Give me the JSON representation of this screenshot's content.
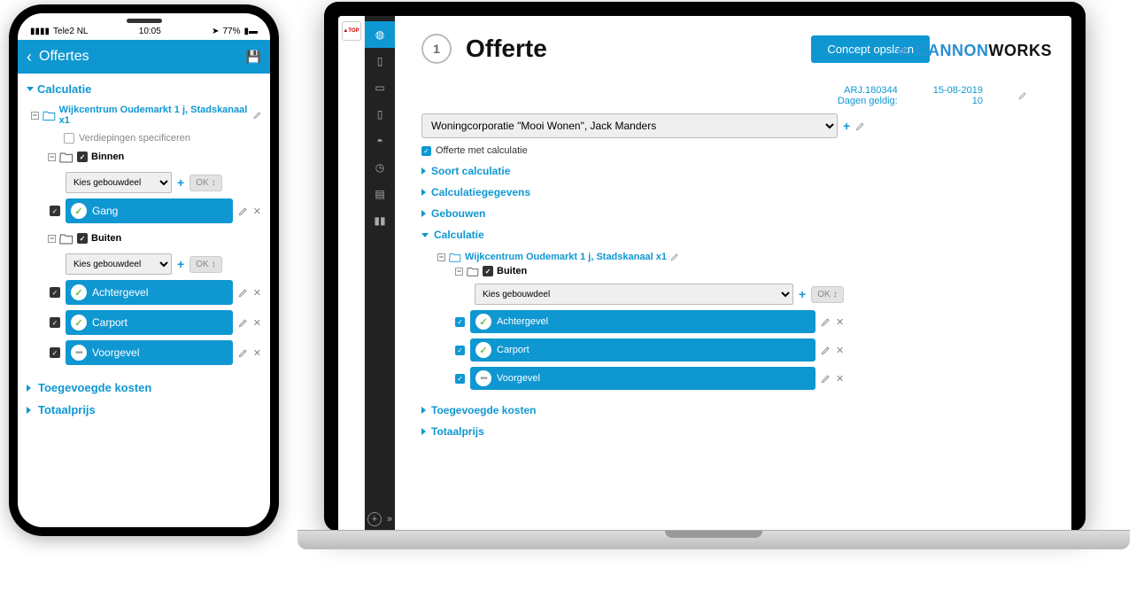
{
  "phone": {
    "carrier": "Tele2 NL",
    "time": "10:05",
    "battery": "77%",
    "header": {
      "title": "Offertes"
    },
    "calc_label": "Calculatie",
    "project": "Wijkcentrum Oudemarkt 1 j, Stadskanaal x1",
    "floors_label": "Verdiepingen specificeren",
    "binnen_label": "Binnen",
    "buiten_label": "Buiten",
    "select_label": "Kies gebouwdeel",
    "ok_label": "OK",
    "items_binnen": [
      "Gang"
    ],
    "items_buiten": [
      "Achtergevel",
      "Carport",
      "Voorgevel"
    ],
    "added_costs": "Toegevoegde kosten",
    "total": "Totaalprijs"
  },
  "laptop": {
    "brand1": "CANNON",
    "brand2": "WORKS",
    "step": "1",
    "title": "Offerte",
    "save_btn": "Concept opslaan",
    "ref": "ARJ.180344",
    "date": "15-08-2019",
    "days_label": "Dagen geldig:",
    "days_val": "10",
    "contact": "Woningcorporatie \"Mooi Wonen\", Jack Manders",
    "with_calc": "Offerte met calculatie",
    "acc": {
      "soort": "Soort calculatie",
      "gegevens": "Calculatiegegevens",
      "gebouwen": "Gebouwen",
      "calculatie": "Calculatie"
    },
    "project": "Wijkcentrum Oudemarkt 1 j, Stadskanaal x1",
    "buiten_label": "Buiten",
    "select_label": "Kies gebouwdeel",
    "ok_label": "OK",
    "items": [
      "Achtergevel",
      "Carport",
      "Voorgevel"
    ],
    "added_costs": "Toegevoegde kosten",
    "total": "Totaalprijs"
  }
}
